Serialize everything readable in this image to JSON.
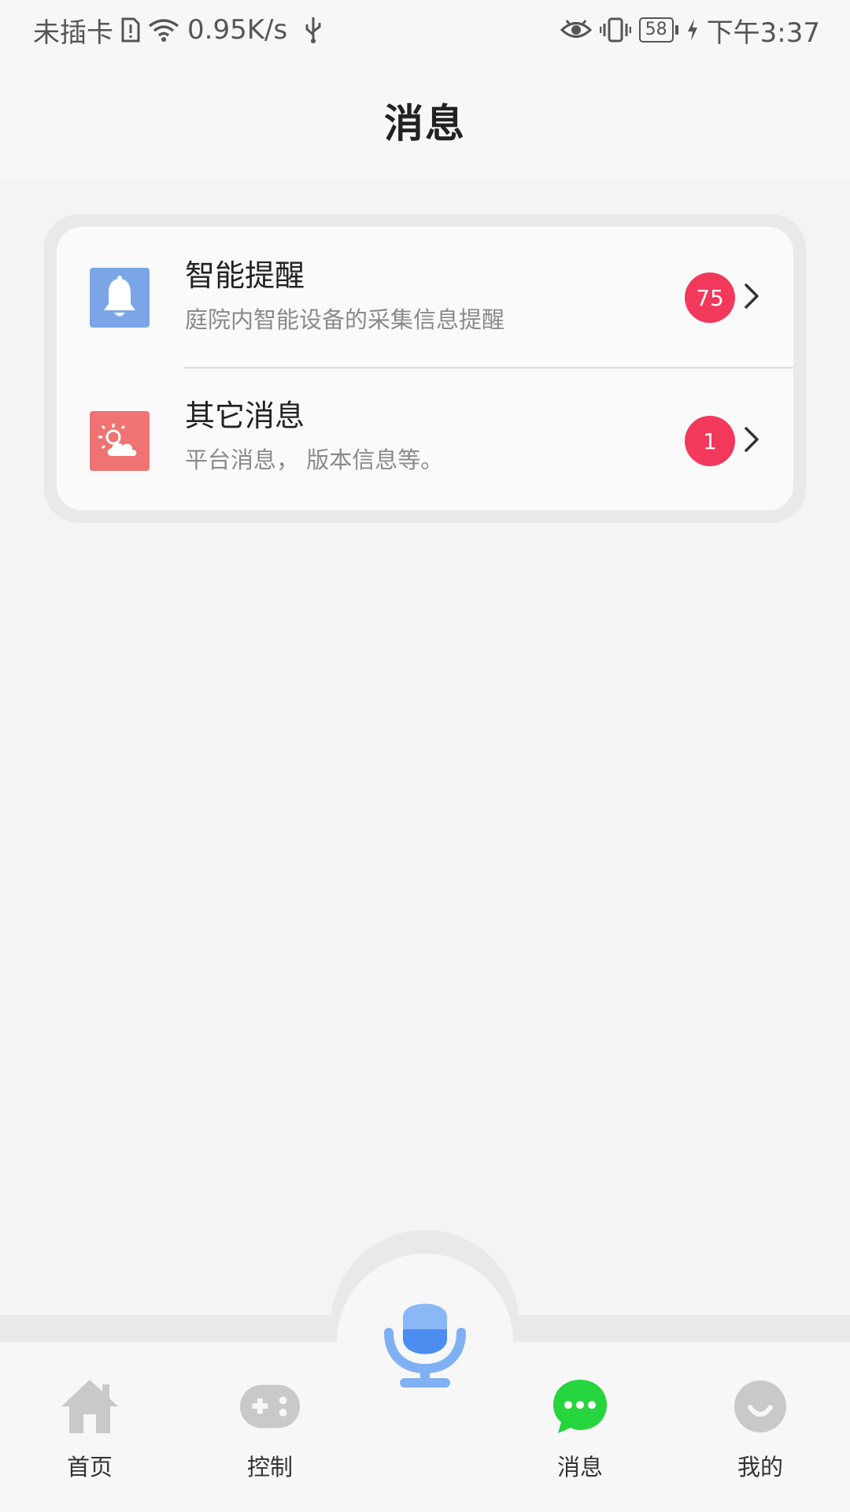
{
  "status_bar": {
    "carrier": "未插卡",
    "speed": "0.95K/s",
    "battery": "58",
    "time": "下午3:37"
  },
  "header": {
    "title": "消息"
  },
  "messages": [
    {
      "title": "智能提醒",
      "desc": "庭院内智能设备的采集信息提醒",
      "badge": "75",
      "icon": "bell-icon",
      "icon_color": "#7aa6e8"
    },
    {
      "title": "其它消息",
      "desc": "平台消息， 版本信息等。",
      "badge": "1",
      "icon": "cloud-sun-icon",
      "icon_color": "#ef7373"
    }
  ],
  "colors": {
    "badge": "#f2395b",
    "active_tab": "#26d43d",
    "inactive_icon": "#c9c9c9",
    "mic": "#7fb0f4"
  },
  "nav": {
    "home": "首页",
    "control": "控制",
    "messages": "消息",
    "mine": "我的"
  }
}
